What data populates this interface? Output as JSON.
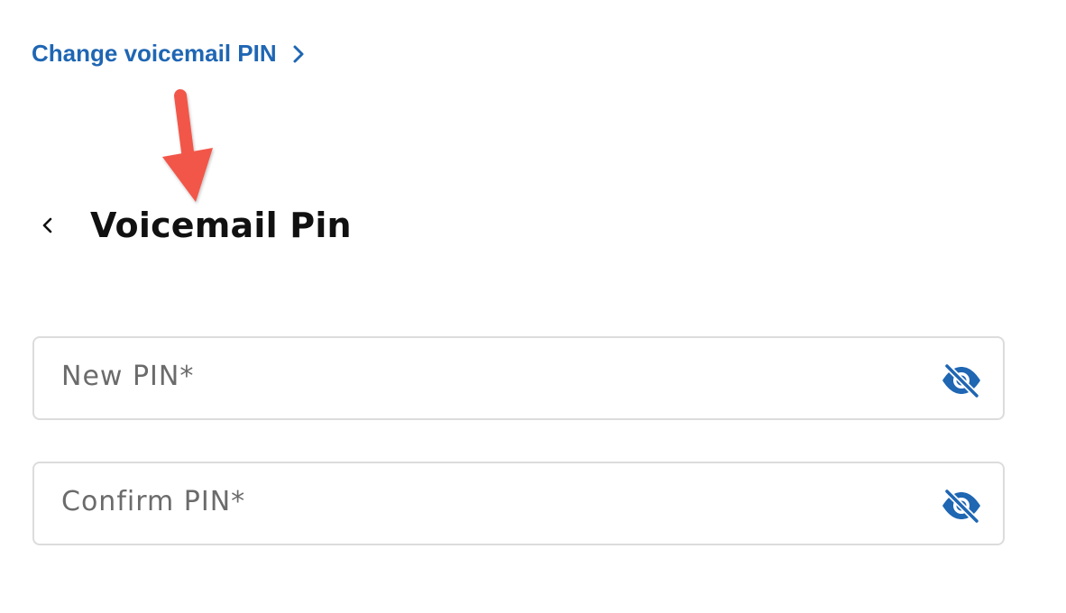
{
  "link": {
    "change_pin_label": "Change voicemail PIN"
  },
  "header": {
    "title": "Voicemail Pin"
  },
  "form": {
    "new_pin": {
      "placeholder": "New PIN*",
      "value": ""
    },
    "confirm_pin": {
      "placeholder": "Confirm PIN*",
      "value": ""
    }
  },
  "icons": {
    "link_chevron": "chevron-right-icon",
    "back": "chevron-left-icon",
    "visibility": "eye-off-icon",
    "annotation": "arrow-down-icon"
  },
  "colors": {
    "link": "#1f66b3",
    "icon": "#1f66b3",
    "annotation_arrow": "#f2574a",
    "border": "#dcdcdc",
    "title": "#111111",
    "placeholder": "#6b6b6b"
  }
}
